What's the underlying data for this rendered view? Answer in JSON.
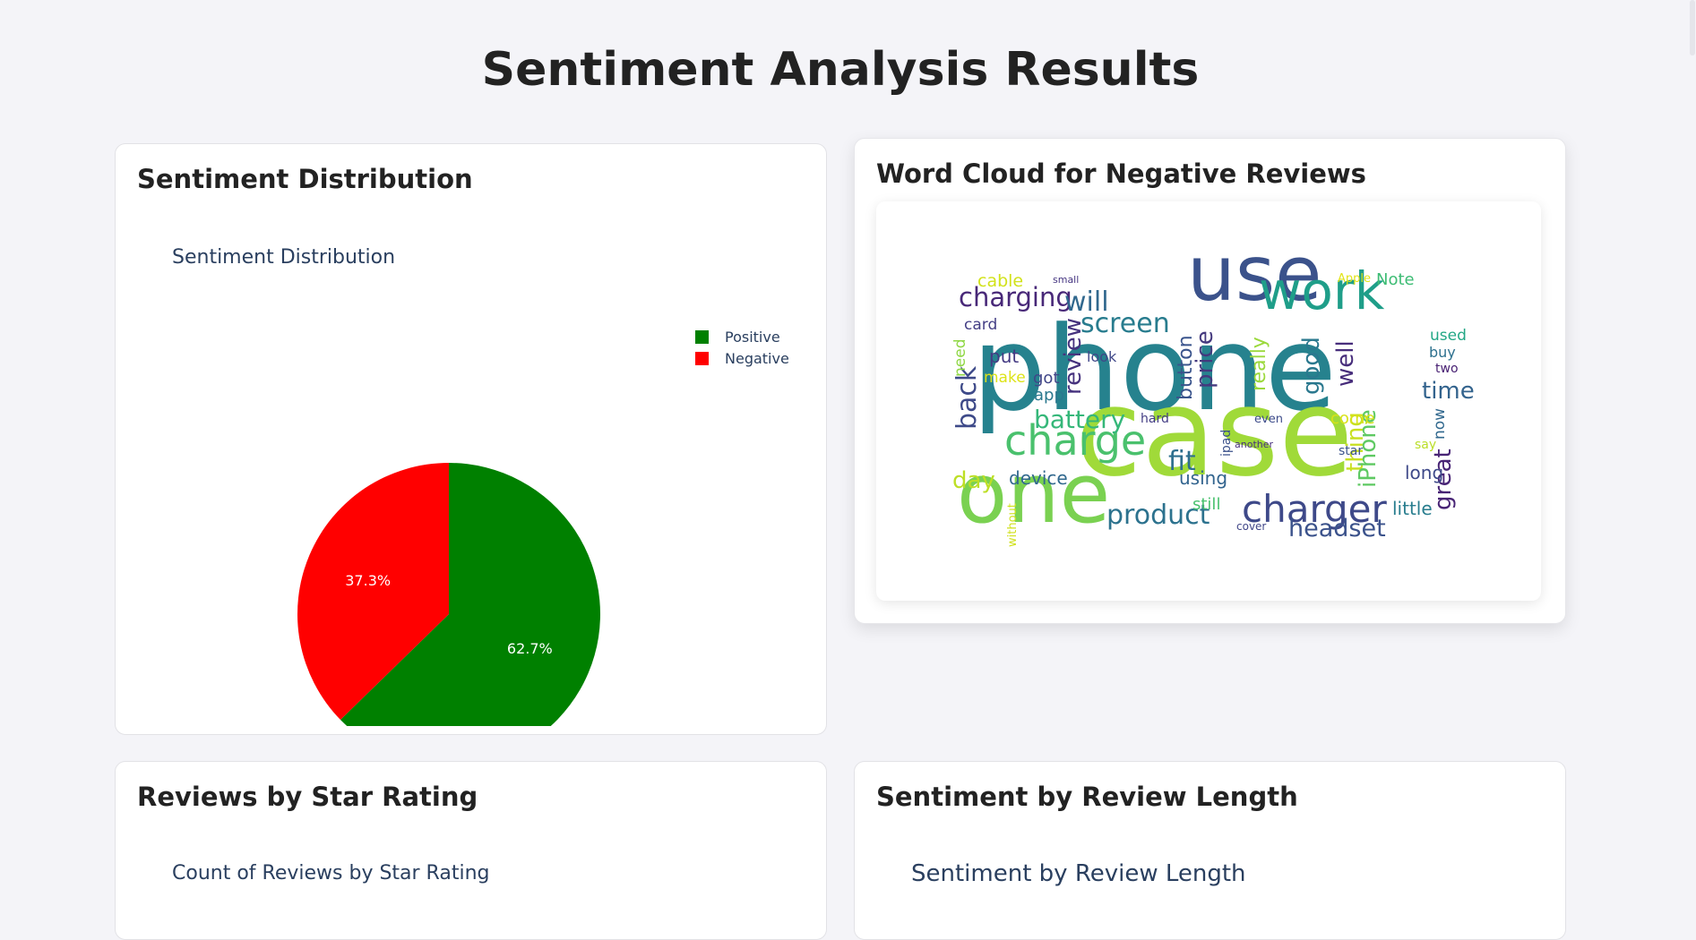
{
  "page": {
    "title": "Sentiment Analysis Results"
  },
  "cards": {
    "sentiment_distribution": {
      "heading": "Sentiment Distribution",
      "plot_title": "Sentiment Distribution"
    },
    "word_cloud": {
      "heading": "Word Cloud for Negative Reviews"
    },
    "star_rating": {
      "heading": "Reviews by Star Rating",
      "plot_title": "Count of Reviews by Star Rating"
    },
    "review_length": {
      "heading": "Sentiment by Review Length",
      "plot_title": "Sentiment by Review Length"
    }
  },
  "legend": [
    {
      "label": "Positive",
      "color": "#008000"
    },
    {
      "label": "Negative",
      "color": "#ff0000"
    }
  ],
  "chart_data": {
    "type": "pie",
    "title": "Sentiment Distribution",
    "labels": [
      "Positive",
      "Negative"
    ],
    "values": [
      62.7,
      37.3
    ],
    "value_labels": [
      "62.7%",
      "37.3%"
    ],
    "colors": [
      "#008000",
      "#ff0000"
    ],
    "legend_position": "top-right"
  },
  "word_cloud": {
    "words": [
      {
        "text": "phone",
        "color": "#26828e"
      },
      {
        "text": "case",
        "color": "#a0da39"
      },
      {
        "text": "use",
        "color": "#3b528b"
      },
      {
        "text": "one",
        "color": "#7ad151"
      },
      {
        "text": "work",
        "color": "#1f9e89"
      },
      {
        "text": "charge",
        "color": "#4ac16d"
      },
      {
        "text": "charger",
        "color": "#3e4989"
      },
      {
        "text": "charging",
        "color": "#482878"
      },
      {
        "text": "will",
        "color": "#31688e"
      },
      {
        "text": "screen",
        "color": "#287c8e"
      },
      {
        "text": "battery",
        "color": "#35b779"
      },
      {
        "text": "product",
        "color": "#2c728e"
      },
      {
        "text": "headset",
        "color": "#3b528b"
      },
      {
        "text": "device",
        "color": "#31688e"
      },
      {
        "text": "day",
        "color": "#bddf26"
      },
      {
        "text": "back",
        "color": "#3e4a89"
      },
      {
        "text": "review",
        "color": "#46327e"
      },
      {
        "text": "time",
        "color": "#33638d"
      },
      {
        "text": "great",
        "color": "#482475"
      },
      {
        "text": "good",
        "color": "#2a788e"
      },
      {
        "text": "well",
        "color": "#472d7b"
      },
      {
        "text": "fit",
        "color": "#2e6f8e"
      },
      {
        "text": "price",
        "color": "#44397e"
      },
      {
        "text": "really",
        "color": "#9bd93c"
      },
      {
        "text": "thing",
        "color": "#c8e020"
      },
      {
        "text": "iPhone",
        "color": "#5ec962"
      },
      {
        "text": "little",
        "color": "#287d8e"
      },
      {
        "text": "long",
        "color": "#3e4989"
      },
      {
        "text": "using",
        "color": "#32648e"
      },
      {
        "text": "button",
        "color": "#3a548c"
      },
      {
        "text": "cable",
        "color": "#d2e21b"
      },
      {
        "text": "card",
        "color": "#433e85"
      },
      {
        "text": "Note",
        "color": "#3dbc74"
      },
      {
        "text": "used",
        "color": "#22a785"
      },
      {
        "text": "buy",
        "color": "#2d708e"
      },
      {
        "text": "put",
        "color": "#443a83"
      },
      {
        "text": "got",
        "color": "#404688"
      },
      {
        "text": "app",
        "color": "#2a788e"
      },
      {
        "text": "look",
        "color": "#3f4788"
      },
      {
        "text": "make",
        "color": "#dde318"
      },
      {
        "text": "need",
        "color": "#8fd744"
      },
      {
        "text": "now",
        "color": "#31688e"
      },
      {
        "text": "still",
        "color": "#48c16e"
      },
      {
        "text": "come",
        "color": "#d8e219"
      },
      {
        "text": "hard",
        "color": "#433d84"
      },
      {
        "text": "even",
        "color": "#3e4c8a"
      },
      {
        "text": "say",
        "color": "#bade28"
      },
      {
        "text": "star",
        "color": "#3b528b"
      },
      {
        "text": "two",
        "color": "#482173"
      },
      {
        "text": "cover",
        "color": "#404688"
      },
      {
        "text": "Apple",
        "color": "#e2e418"
      },
      {
        "text": "small",
        "color": "#453581"
      },
      {
        "text": "ipad",
        "color": "#3b518b"
      },
      {
        "text": "without",
        "color": "#d0e11c"
      },
      {
        "text": "another",
        "color": "#472f7d"
      }
    ]
  }
}
